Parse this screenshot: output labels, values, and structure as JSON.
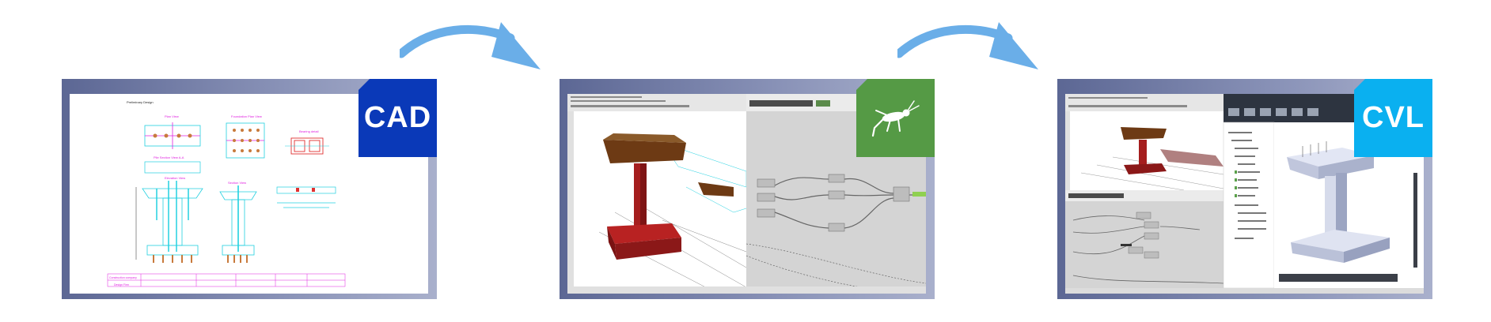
{
  "colors": {
    "panel_gradient_start": "#5c6794",
    "panel_gradient_end": "#a9b0cc",
    "arrow": "#6aaee8",
    "cad_badge": "#0a39b8",
    "grasshopper_badge": "#559a45",
    "cvl_badge": "#0ab0f0",
    "pier_red": "#a51e1e",
    "drawing_magenta": "#e020e0",
    "drawing_cyan": "#22d0e0"
  },
  "steps": [
    {
      "id": "cad",
      "badge_label": "CAD",
      "badge_icon": null
    },
    {
      "id": "grasshopper",
      "badge_label": "",
      "badge_icon": "grasshopper-icon"
    },
    {
      "id": "cvl",
      "badge_label": "CVL",
      "badge_icon": null
    }
  ],
  "cad_drawing": {
    "sheet_title": "Preliminary Design",
    "view_labels": [
      "Plan View",
      "Foundation Plan View",
      "Pile Section View A-A",
      "Bearing detail",
      "Elevation View",
      "Section View"
    ],
    "title_block": [
      "Construction company",
      "Design Firm"
    ]
  },
  "arrows": [
    "arrow-right-curved",
    "arrow-right-curved"
  ]
}
